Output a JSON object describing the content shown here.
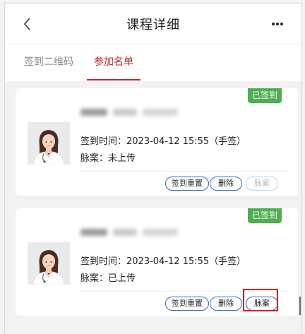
{
  "header": {
    "title": "课程详细"
  },
  "tabs": [
    {
      "label": "签到二维码",
      "active": false
    },
    {
      "label": "参加名单",
      "active": true
    }
  ],
  "colors": {
    "accent": "#c0292b",
    "badge": "#4caf50",
    "button_border": "#2b67c9",
    "highlight": "#e01919"
  },
  "cards": [
    {
      "status": "已签到",
      "checkin_label": "签到时间：",
      "checkin_value": "2023-04-12 15:55（手签）",
      "case_label": "脉案：",
      "case_value": "未上传",
      "buttons": {
        "reset": "签到重置",
        "delete": "删除",
        "case": "脉案"
      },
      "case_enabled": false
    },
    {
      "status": "已签到",
      "checkin_label": "签到时间：",
      "checkin_value": "2023-04-12 15:55（手签）",
      "case_label": "脉案：",
      "case_value": "已上传",
      "buttons": {
        "reset": "签到重置",
        "delete": "删除",
        "case": "脉案"
      },
      "case_enabled": true
    }
  ]
}
